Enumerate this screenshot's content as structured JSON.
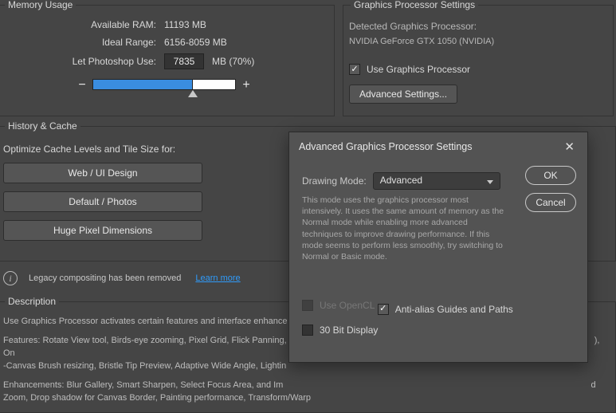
{
  "memory": {
    "group_label": "Memory Usage",
    "available_label": "Available RAM:",
    "available_value": "11193 MB",
    "ideal_label": "Ideal Range:",
    "ideal_value": "6156-8059 MB",
    "let_use_label": "Let Photoshop Use:",
    "let_use_value": "7835",
    "let_use_suffix": "MB (70%)",
    "slider_fill_pct": 70
  },
  "gpu": {
    "group_label": "Graphics Processor Settings",
    "detected_label": "Detected Graphics Processor:",
    "detected_value": "NVIDIA GeForce GTX 1050 (NVIDIA)",
    "use_gpu_label": "Use Graphics Processor",
    "advanced_btn": "Advanced Settings..."
  },
  "history": {
    "group_label": "History & Cache",
    "optimize_label": "Optimize Cache Levels and Tile Size for:",
    "btn_web": "Web / UI Design",
    "btn_default": "Default / Photos",
    "btn_huge": "Huge Pixel Dimensions"
  },
  "info": {
    "text": "Legacy compositing has been removed",
    "link": "Learn more"
  },
  "description": {
    "group_label": "Description",
    "line1": "Use Graphics Processor activates certain features and interface enhance",
    "line2a": "Features: Rotate View tool, Birds-eye zooming, Pixel Grid, Flick Panning, ",
    "line2b": "), On",
    "line3": "-Canvas Brush resizing, Bristle Tip Preview, Adaptive Wide Angle, Lightin",
    "line4a": "Enhancements: Blur Gallery, Smart Sharpen, Select Focus Area, and Im",
    "line4b": "d",
    "line5": "Zoom, Drop shadow for Canvas Border, Painting performance, Transform/Warp"
  },
  "modal": {
    "title": "Advanced Graphics Processor Settings",
    "drawing_mode_label": "Drawing Mode:",
    "drawing_mode_value": "Advanced",
    "mode_desc": "This mode uses the graphics processor most intensively.  It uses the same amount of memory as the Normal mode while enabling more advanced techniques to improve drawing performance.  If this mode seems to perform less smoothly, try switching to Normal or Basic mode.",
    "use_opencl": "Use OpenCL",
    "antialias": "Anti-alias Guides and Paths",
    "thirty_bit": "30 Bit Display",
    "ok": "OK",
    "cancel": "Cancel"
  }
}
